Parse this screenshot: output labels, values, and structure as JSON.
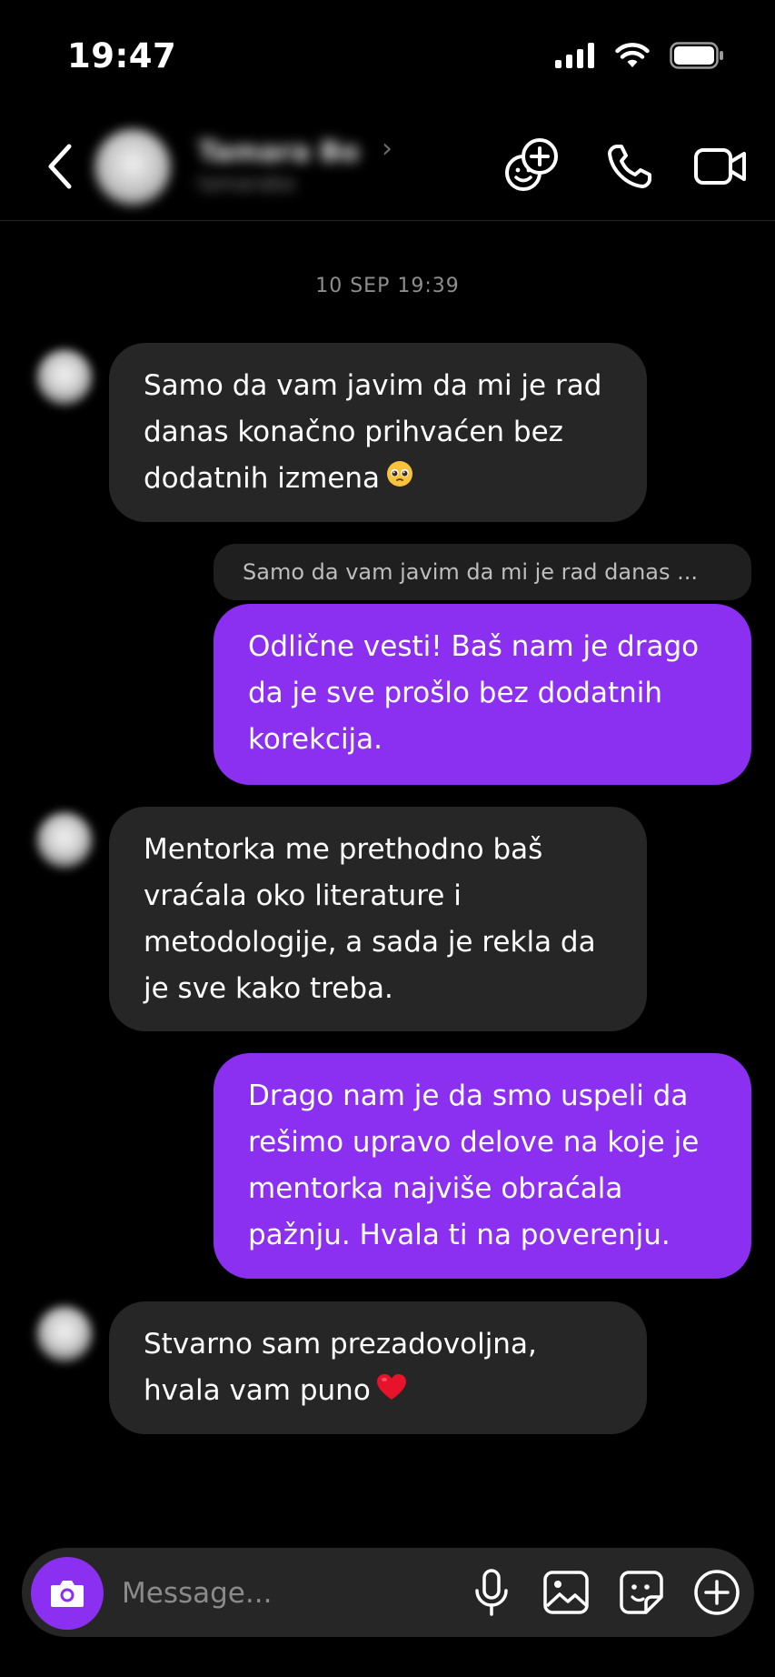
{
  "status_bar": {
    "time": "19:47"
  },
  "header": {
    "contact_name": "Tamara Bo",
    "contact_subtitle": "tamarabo"
  },
  "thread": {
    "timestamp": "10 SEP 19:39",
    "messages": [
      {
        "direction": "incoming",
        "lines": [
          "Samo da vam javim da mi je rad",
          "danas konačno prihvaćen bez",
          "dodatnih izmena"
        ],
        "emoji": "pleading-face"
      },
      {
        "direction": "outgoing",
        "reply_to": "Samo da vam javim da mi je rad danas ...",
        "lines": [
          "Odlične vesti! Baš nam je drago",
          "da je sve prošlo bez dodatnih",
          "korekcija."
        ]
      },
      {
        "direction": "incoming",
        "lines": [
          "Mentorka me prethodno baš",
          "vraćala oko literature i",
          "metodologije, a sada je rekla da",
          "je sve kako treba."
        ]
      },
      {
        "direction": "outgoing",
        "lines": [
          "Drago nam je da smo uspeli da",
          "rešimo upravo delove na koje je",
          "mentorka najviše obraćala",
          "pažnju. Hvala ti na poverenju."
        ]
      },
      {
        "direction": "incoming",
        "lines": [
          "Stvarno sam prezadovoljna,",
          "hvala vam puno"
        ],
        "emoji": "red-heart"
      }
    ]
  },
  "composer": {
    "placeholder": "Message..."
  },
  "colors": {
    "accent": "#8b2ff0",
    "incoming_bubble": "#262626",
    "background": "#000000"
  },
  "icons": [
    "back-chevron-icon",
    "add-people-icon",
    "phone-icon",
    "video-camera-icon",
    "camera-icon",
    "microphone-icon",
    "gallery-icon",
    "sticker-icon",
    "plus-icon"
  ]
}
